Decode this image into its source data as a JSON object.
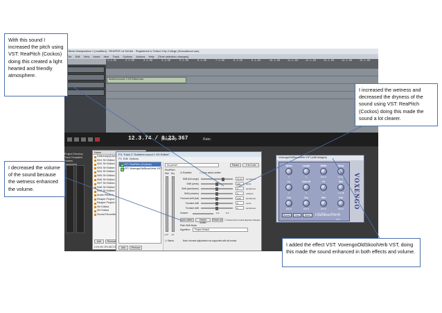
{
  "callouts": {
    "top_left": "With this sound I increased the pitch using VST: ReaPitch (Cockos) doing this created a light hearted and friendly atmosphere.",
    "top_right": "I increased the wetness and decreased the dryness of the sound using VST: ReaPitch (Cockos) doing this made the sound a lot clearer.",
    "mid_left": "I decreased the volume of the sound because the wetness enhanced the volume.",
    "bottom_right": "I added the effect VST: VoxengoOldSkoolVerb VST, doing this made the sound enhanced in both effects and volume."
  },
  "daw": {
    "title": "Effects Manipulation 1 [modified] - REAPER v4.26/x64 - Registered to Telford City College (Educational use)",
    "menu": [
      "File",
      "Edit",
      "View",
      "Insert",
      "Item",
      "Track",
      "Options",
      "Actions",
      "Help",
      "[Time selection changes]"
    ],
    "ruler_ticks": [
      "1.1.00",
      "2.1.00",
      "3.1.00",
      "4.1.00",
      "5.1.00",
      "6.1.00",
      "7.1.00",
      "8.1.00",
      "9.1.00",
      "10.1.00",
      "11.1.00",
      "12.1.00",
      "13.1.00",
      "14.1.00",
      "15.1.00"
    ],
    "item_label": "Ambient sound 1 SH Edited.wav",
    "time": "12.3.74 / 0:23.367",
    "status": "[Stopped]",
    "rate_label": "Rate:"
  },
  "explorer": {
    "header": "Name",
    "rows": [
      "Dictionary/(User)",
      "SH1 SH Edited",
      "SH2 SH Edited",
      "SH3 SH Edited",
      "SH4 SH Edited",
      "SH5 SH Edited",
      "SH6 SH Edited",
      "SH7 SH Edited",
      "SH8 SH Edited",
      "SH9 SH Edited",
      "Audio Pitched",
      "Reaper Project 1",
      "Reaper Project SH",
      "SH Edited",
      "SH Edited",
      "Sound Recording"
    ],
    "sidebar": [
      "Project Directory",
      "Track Templates",
      "Folders",
      "Documents",
      "C:\\"
    ],
    "btn_add": "Add",
    "btn_remove": "Remove",
    "footer": "0.1% 0% CPU 5672 5973 pfx"
  },
  "fx": {
    "title": "FX: Track 2 \"Ambient sound 1 SH Edited\"",
    "menu": [
      "FX",
      "Edit",
      "Options"
    ],
    "list": [
      "VST: ReaPitch (Cockos)",
      "VST: VoxengoOldSkoolVerb VST"
    ],
    "btn_add": "Add",
    "btn_remove": "Remove",
    "preset": "No preset",
    "param_btn": "Param",
    "preset_btn": "2 in 2 out",
    "reapitch_label": "ReaPitch",
    "wet_label": "Wet",
    "dry_label": "Dry",
    "enabled_label": "Enabled",
    "solo_label": "Solo active shifter",
    "rows": [
      {
        "label": "Shift (full range)",
        "value": "23.30",
        "unit": "semitones",
        "pos": 0.72
      },
      {
        "label": "Shift (cents)",
        "value": "100",
        "unit": "cents",
        "pos": 0.5
      },
      {
        "label": "Shift (semitones)",
        "value": "0",
        "unit": "semitones",
        "pos": 0.5
      },
      {
        "label": "Shift (octaves)",
        "value": "0",
        "unit": "octaves",
        "pos": 0.5
      },
      {
        "label": "Formant shift (full)",
        "value": "0.00",
        "unit": "semitones",
        "pos": 0.5
      },
      {
        "label": "Formant shift",
        "value": "0",
        "unit": "cents",
        "pos": 0.5
      },
      {
        "label": "Formant shift",
        "value": "0",
        "unit": "semitones",
        "pos": 0.5
      }
    ],
    "volume_label": "Volume:",
    "volume_value": "0.0",
    "pan_value": "0.0",
    "wet_value": "+0.0",
    "dry_value": "-inf",
    "btn_add_shifter": "Add shifter",
    "btn_delete_shifter": "Delete shifter",
    "btn_reset": "Reset all",
    "auto_label": "Autocorrect muted playrate changes",
    "mode_label": "Pitch Shift Mode",
    "algo_label": "Algorithm:",
    "algo_value": "Project Default",
    "stereo_label": "Stereo",
    "note": "Note: formant adjustment not supported with all modes"
  },
  "verb": {
    "title": "VoxengoOldSkoolVerb VST (x86 bridged)",
    "knobs": [
      {
        "label": "Space",
        "value": "5"
      },
      {
        "label": "Length",
        "value": "0"
      },
      {
        "label": "Width",
        "value": "100 %"
      },
      {
        "label": "Damp",
        "value": "0.0 dB"
      },
      {
        "label": "Lo",
        "value": "0"
      },
      {
        "label": "Color Hi",
        "value": "0"
      },
      {
        "label": "Hi",
        "value": "0"
      },
      {
        "label": "Wet",
        "value": "-2.8 dB"
      },
      {
        "label": "Out",
        "value": "100 %"
      },
      {
        "label": "Dry",
        "value": "100 %"
      },
      {
        "label": "Wet",
        "value": "100 %"
      },
      {
        "label": "Out",
        "value": "100 %"
      }
    ],
    "btn_bypass": "Bypass",
    "btn_copy": "Copy",
    "btn_reset": "Reset",
    "logo": "OldSkoolVerb",
    "version": "v1.4",
    "brand": "VOXENGO"
  }
}
